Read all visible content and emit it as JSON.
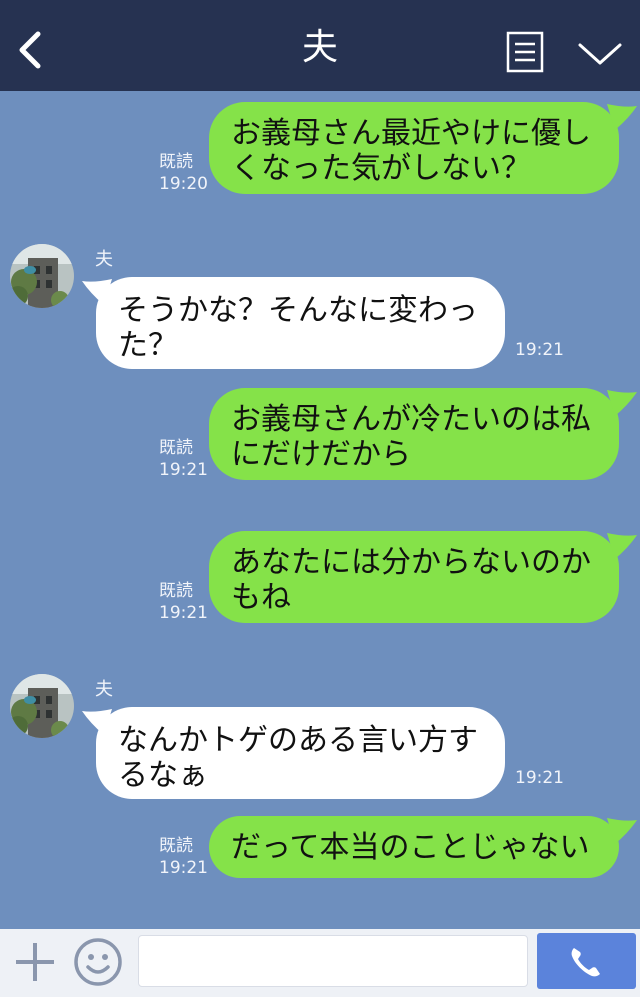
{
  "header": {
    "title": "夫"
  },
  "messages": [
    {
      "id": 1,
      "dir": "out",
      "text_lines": [
        "お義母さん最近やけに優し",
        "くなった気がしない？"
      ],
      "read": "既読",
      "time": "19:20"
    },
    {
      "id": 2,
      "dir": "in",
      "sender": "夫",
      "text_lines": [
        "そうかな？そんなに変わっ",
        "た？"
      ],
      "time": "19:21"
    },
    {
      "id": 3,
      "dir": "out",
      "text_lines": [
        "お義母さんが冷たいのは私",
        "にだけだから"
      ],
      "read": "既読",
      "time": "19:21"
    },
    {
      "id": 4,
      "dir": "out",
      "text_lines": [
        "あなたには分からないのか",
        "もね"
      ],
      "read": "既読",
      "time": "19:21"
    },
    {
      "id": 5,
      "dir": "in",
      "sender": "夫",
      "text_lines": [
        "なんかトゲのある言い方す",
        "るなぁ"
      ],
      "time": "19:21"
    },
    {
      "id": 6,
      "dir": "out",
      "text_lines": [
        "だって本当のことじゃない"
      ],
      "read": "既読",
      "time": "19:21"
    }
  ],
  "composer": {
    "input_value": ""
  },
  "icons": {
    "back": "back-chevron-icon",
    "note": "note-icon",
    "menu": "chevron-down-icon",
    "plus": "plus-icon",
    "emoji": "smile-icon",
    "call": "phone-icon"
  },
  "colors": {
    "header_bg": "#263251",
    "chat_bg": "#6e8fbe",
    "outgoing_bubble": "#85e249",
    "incoming_bubble": "#ffffff",
    "send_button": "#5b83db"
  }
}
